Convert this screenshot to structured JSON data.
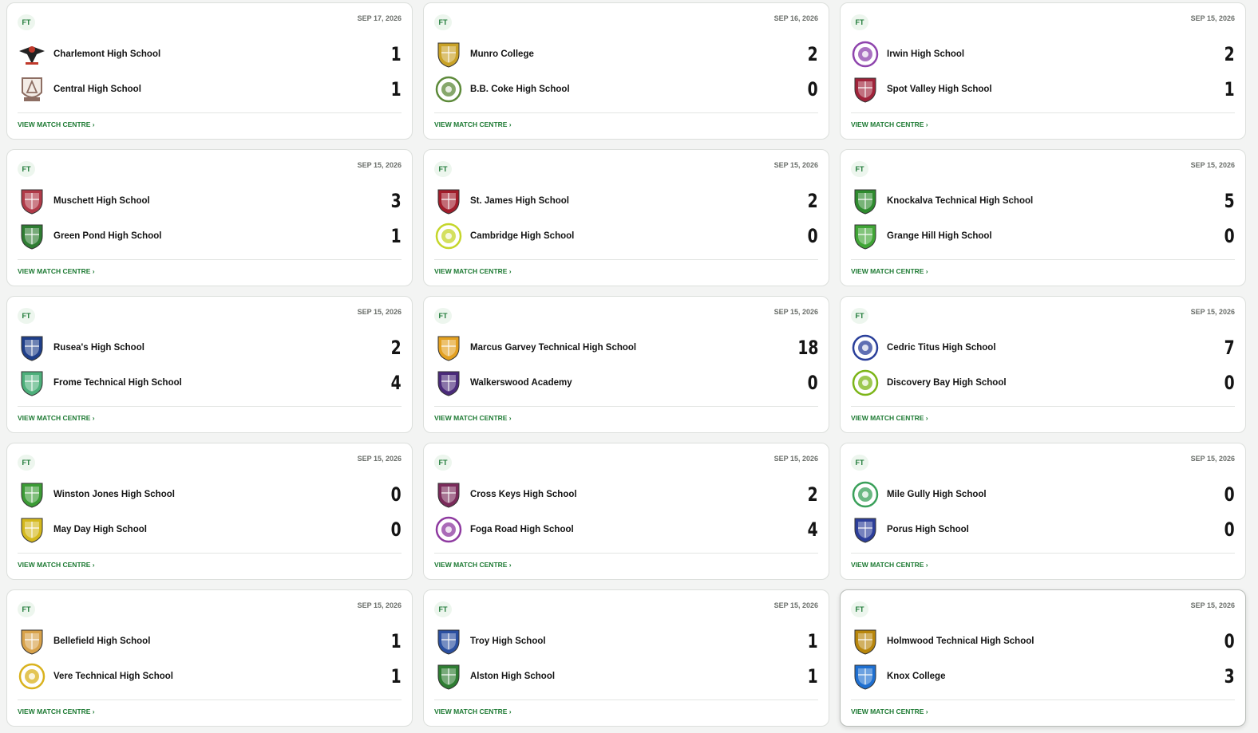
{
  "matches": [
    {
      "status": "FT",
      "date": "SEP 17, 2026",
      "home": {
        "name": "Charlemont High School",
        "score": "1",
        "color": "#c0392b",
        "icon": "crest-eagle"
      },
      "away": {
        "name": "Central High School",
        "score": "1",
        "color": "#8d6e63",
        "icon": "crest-tower"
      },
      "link": "VIEW MATCH CENTRE ›"
    },
    {
      "status": "FT",
      "date": "SEP 16, 2026",
      "home": {
        "name": "Munro College",
        "score": "2",
        "color": "#c9a227",
        "icon": "crest-shield"
      },
      "away": {
        "name": "B.B. Coke High School",
        "score": "0",
        "color": "#5d8a3a",
        "icon": "crest-round"
      },
      "link": "VIEW MATCH CENTRE ›"
    },
    {
      "status": "FT",
      "date": "SEP 15, 2026",
      "home": {
        "name": "Irwin High School",
        "score": "2",
        "color": "#8e44ad",
        "icon": "crest-round"
      },
      "away": {
        "name": "Spot Valley High School",
        "score": "1",
        "color": "#a0233a",
        "icon": "crest-shield"
      },
      "link": "VIEW MATCH CENTRE ›"
    },
    {
      "status": "FT",
      "date": "SEP 15, 2026",
      "home": {
        "name": "Muschett High School",
        "score": "3",
        "color": "#b03a48",
        "icon": "crest-shield"
      },
      "away": {
        "name": "Green Pond High School",
        "score": "1",
        "color": "#2e7d32",
        "icon": "crest-shield"
      },
      "link": "VIEW MATCH CENTRE ›"
    },
    {
      "status": "FT",
      "date": "SEP 15, 2026",
      "home": {
        "name": "St. James High School",
        "score": "2",
        "color": "#a11d2b",
        "icon": "crest-shield"
      },
      "away": {
        "name": "Cambridge High School",
        "score": "0",
        "color": "#c5d62a",
        "icon": "crest-round"
      },
      "link": "VIEW MATCH CENTRE ›"
    },
    {
      "status": "FT",
      "date": "SEP 15, 2026",
      "home": {
        "name": "Knockalva Technical High School",
        "score": "5",
        "color": "#2e8b2e",
        "icon": "crest-shield"
      },
      "away": {
        "name": "Grange Hill High School",
        "score": "0",
        "color": "#3fa535",
        "icon": "crest-shield"
      },
      "link": "VIEW MATCH CENTRE ›"
    },
    {
      "status": "FT",
      "date": "SEP 15, 2026",
      "home": {
        "name": "Rusea's High School",
        "score": "2",
        "color": "#1f3f8a",
        "icon": "crest-shield"
      },
      "away": {
        "name": "Frome Technical High School",
        "score": "4",
        "color": "#4caf7a",
        "icon": "crest-shield"
      },
      "link": "VIEW MATCH CENTRE ›"
    },
    {
      "status": "FT",
      "date": "SEP 15, 2026",
      "home": {
        "name": "Marcus Garvey Technical High School",
        "score": "18",
        "color": "#e3a020",
        "icon": "crest-shield"
      },
      "away": {
        "name": "Walkerswood Academy",
        "score": "0",
        "color": "#4a2a7a",
        "icon": "crest-shield"
      },
      "link": "VIEW MATCH CENTRE ›"
    },
    {
      "status": "FT",
      "date": "SEP 15, 2026",
      "home": {
        "name": "Cedric Titus High School",
        "score": "7",
        "color": "#2a3f9a",
        "icon": "crest-round"
      },
      "away": {
        "name": "Discovery Bay High School",
        "score": "0",
        "color": "#7cb518",
        "icon": "crest-round"
      },
      "link": "VIEW MATCH CENTRE ›"
    },
    {
      "status": "FT",
      "date": "SEP 15, 2026",
      "home": {
        "name": "Winston Jones High School",
        "score": "0",
        "color": "#3b9b35",
        "icon": "crest-shield"
      },
      "away": {
        "name": "May Day High School",
        "score": "0",
        "color": "#d4b81c",
        "icon": "crest-shield"
      },
      "link": "VIEW MATCH CENTRE ›"
    },
    {
      "status": "FT",
      "date": "SEP 15, 2026",
      "home": {
        "name": "Cross Keys High School",
        "score": "2",
        "color": "#7a2a5a",
        "icon": "crest-shield"
      },
      "away": {
        "name": "Foga Road High School",
        "score": "4",
        "color": "#8e3aa0",
        "icon": "crest-round"
      },
      "link": "VIEW MATCH CENTRE ›"
    },
    {
      "status": "FT",
      "date": "SEP 15, 2026",
      "home": {
        "name": "Mile Gully High School",
        "score": "0",
        "color": "#3aa05a",
        "icon": "crest-round"
      },
      "away": {
        "name": "Porus High School",
        "score": "0",
        "color": "#2c3e9a",
        "icon": "crest-shield"
      },
      "link": "VIEW MATCH CENTRE ›"
    },
    {
      "status": "FT",
      "date": "SEP 15, 2026",
      "home": {
        "name": "Bellefield High School",
        "score": "1",
        "color": "#d8a24a",
        "icon": "crest-shield"
      },
      "away": {
        "name": "Vere Technical High School",
        "score": "1",
        "color": "#d9b21e",
        "icon": "crest-round"
      },
      "link": "VIEW MATCH CENTRE ›"
    },
    {
      "status": "FT",
      "date": "SEP 15, 2026",
      "home": {
        "name": "Troy High School",
        "score": "1",
        "color": "#2a4fa0",
        "icon": "crest-shield"
      },
      "away": {
        "name": "Alston High School",
        "score": "1",
        "color": "#2e7d32",
        "icon": "crest-shield"
      },
      "link": "VIEW MATCH CENTRE ›"
    },
    {
      "status": "FT",
      "date": "SEP 15, 2026",
      "home": {
        "name": "Holmwood Technical High School",
        "score": "0",
        "color": "#b8860b",
        "icon": "crest-shield"
      },
      "away": {
        "name": "Knox College",
        "score": "3",
        "color": "#1e6fd0",
        "icon": "crest-shield"
      },
      "link": "VIEW MATCH CENTRE ›"
    }
  ]
}
